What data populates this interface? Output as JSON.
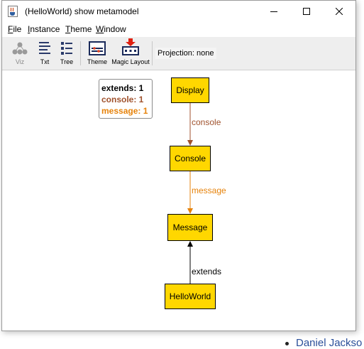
{
  "window": {
    "title": "(HelloWorld) show metamodel"
  },
  "menu": {
    "file": {
      "mnemonic": "F",
      "rest": "ile"
    },
    "instance": {
      "mnemonic": "I",
      "rest": "nstance"
    },
    "theme": {
      "mnemonic": "T",
      "rest": "heme"
    },
    "window": {
      "mnemonic": "W",
      "rest": "indow"
    }
  },
  "toolbar": {
    "viz": "Viz",
    "txt": "Txt",
    "tree": "Tree",
    "theme": "Theme",
    "magic_layout": "Magic Layout",
    "projection": "Projection: none"
  },
  "legend": {
    "extends": "extends: 1",
    "console": "console: 1",
    "message": "message: 1",
    "colors": {
      "extends": "#000000",
      "console": "#a0522d",
      "message": "#e6820a"
    }
  },
  "graph": {
    "nodes": {
      "display": "Display",
      "console": "Console",
      "message": "Message",
      "helloworld": "HelloWorld"
    },
    "edges": {
      "console": "console",
      "message": "message",
      "extends": "extends"
    },
    "node_color": "#ffd700"
  },
  "background": {
    "bullet_text": "Daniel Jackso"
  }
}
